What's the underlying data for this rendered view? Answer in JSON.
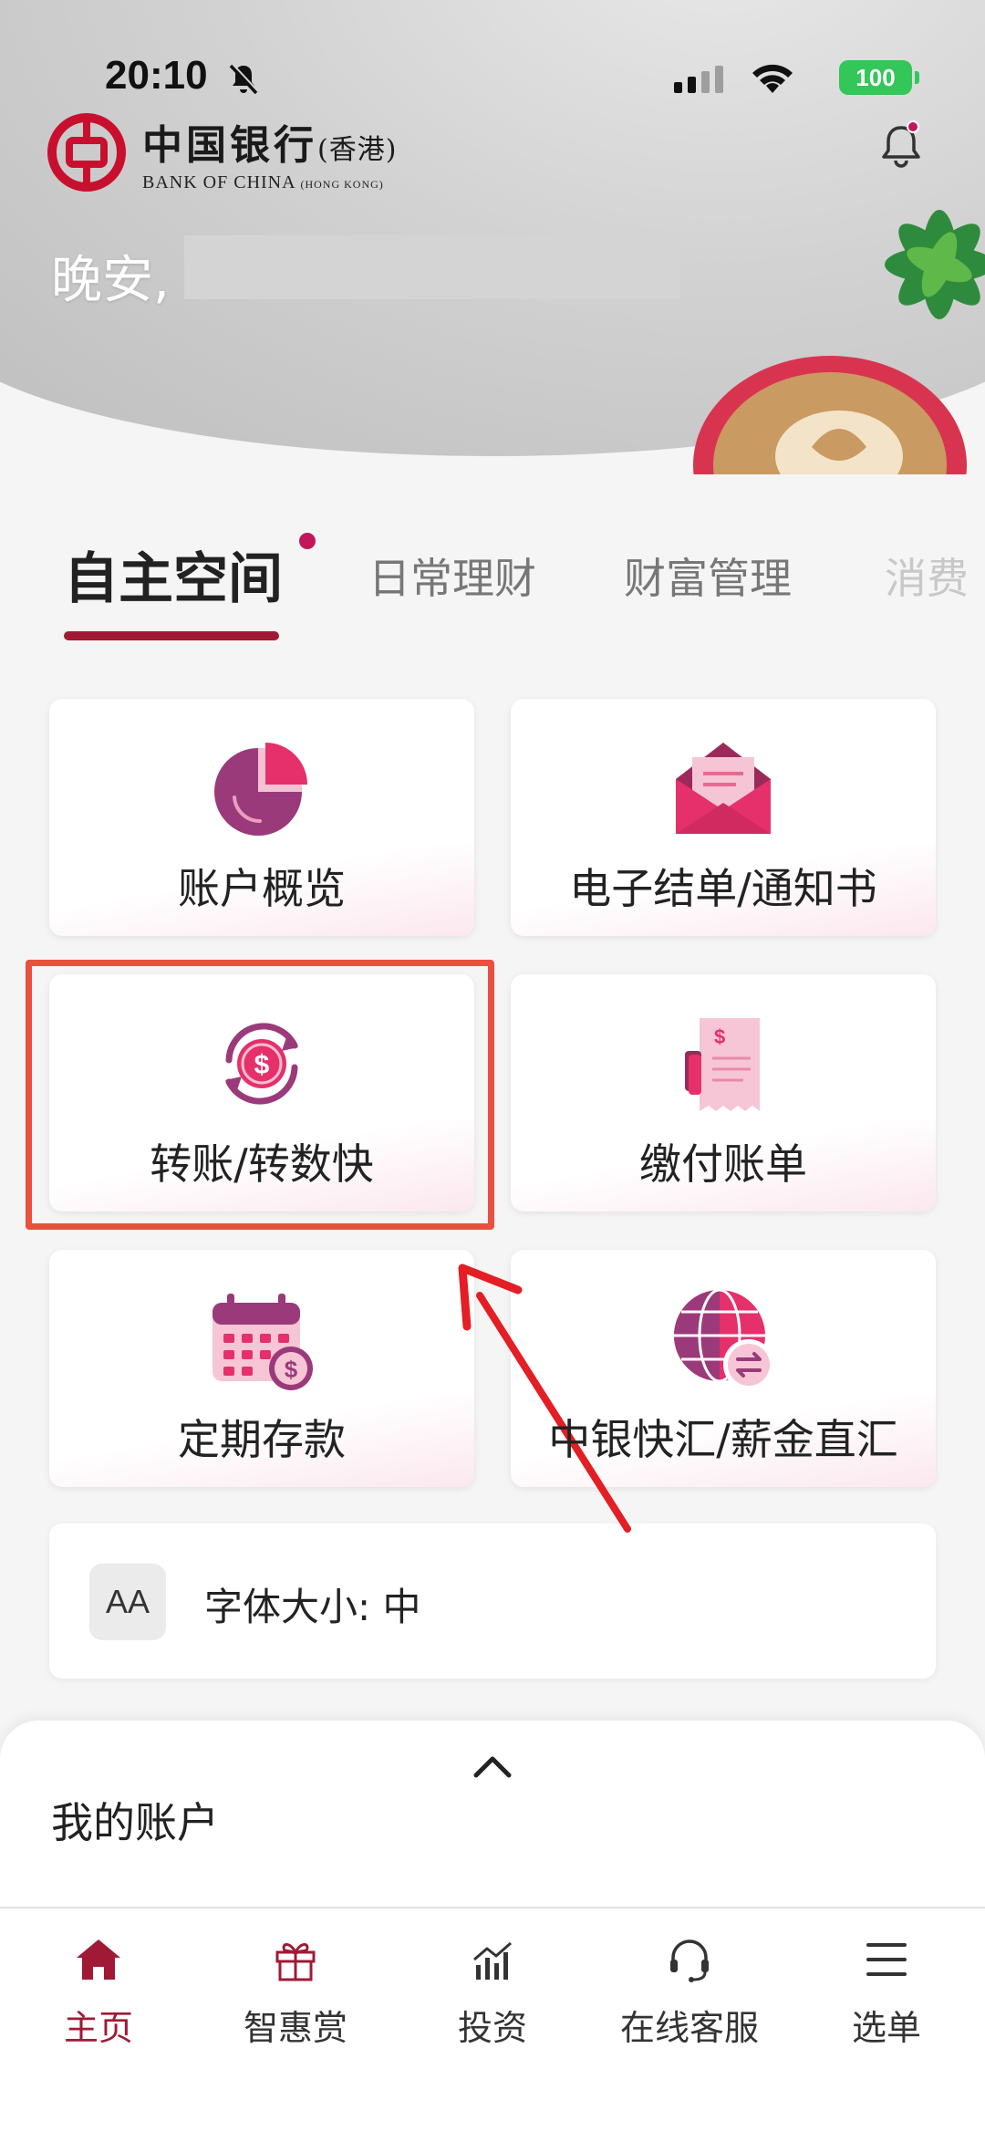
{
  "status_bar": {
    "time": "20:10",
    "battery": "100"
  },
  "brand": {
    "name_cn": "中国银行",
    "region_cn": "(香港)",
    "name_en": "BANK OF CHINA",
    "region_en": "(HONG KONG)"
  },
  "greeting": "晚安,",
  "tabs": [
    {
      "label": "自主空间",
      "active": true
    },
    {
      "label": "日常理财"
    },
    {
      "label": "财富管理"
    },
    {
      "label": "消费"
    }
  ],
  "tiles": [
    {
      "label": "账户概览",
      "icon": "pie-chart-icon"
    },
    {
      "label": "电子结单/通知书",
      "icon": "envelope-icon"
    },
    {
      "label": "转账/转数快",
      "icon": "dollar-transfer-icon"
    },
    {
      "label": "缴付账单",
      "icon": "bill-icon"
    },
    {
      "label": "定期存款",
      "icon": "calendar-deposit-icon"
    },
    {
      "label": "中银快汇/薪金直汇",
      "icon": "globe-exchange-icon"
    }
  ],
  "font_size": {
    "icon_text": "AA",
    "label": "字体大小:  中"
  },
  "sheet": {
    "title": "我的账户"
  },
  "nav": [
    {
      "label": "主页",
      "icon": "home-icon",
      "active": true
    },
    {
      "label": "智惠赏",
      "icon": "gift-icon"
    },
    {
      "label": "投资",
      "icon": "investment-chart-icon"
    },
    {
      "label": "在线客服",
      "icon": "headset-icon"
    },
    {
      "label": "选单",
      "icon": "menu-icon"
    }
  ],
  "colors": {
    "brand_red": "#a01a35",
    "accent_pink": "#d63c6a",
    "highlight_box": "#e9503f",
    "annotation_arrow": "#e31e24",
    "battery_green": "#33c759"
  }
}
